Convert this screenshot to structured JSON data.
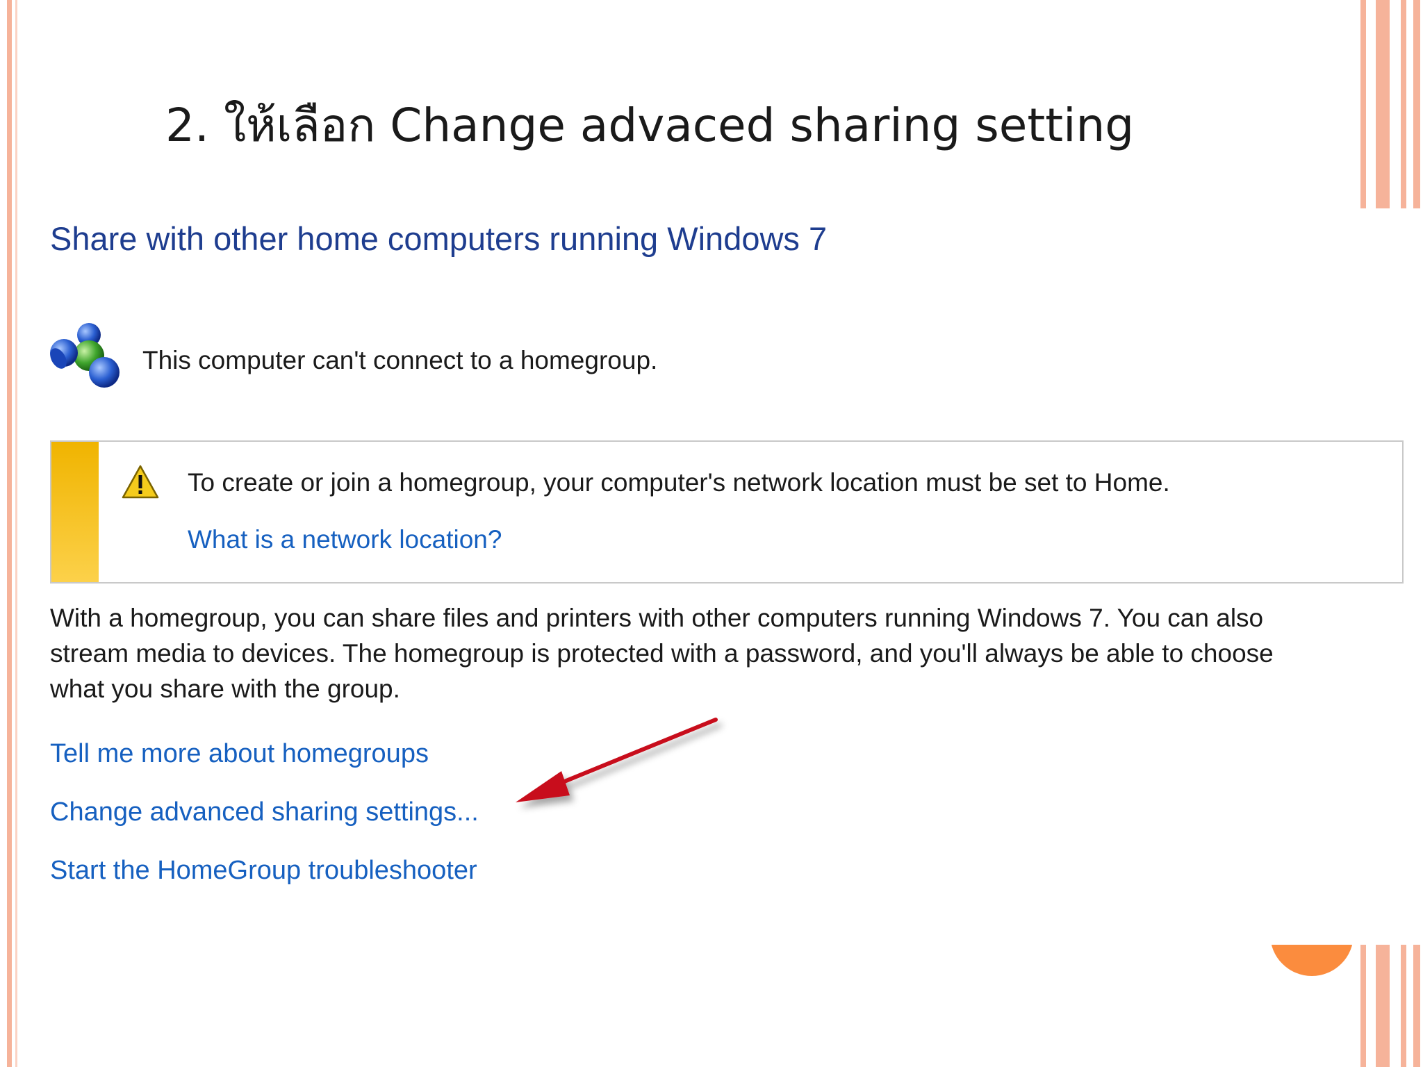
{
  "slide": {
    "title": "2. ให้เลือก Change advaced sharing setting"
  },
  "panel": {
    "heading": "Share with other home computers running Windows 7",
    "status_icon": "homegroup-icon",
    "status_text": "This computer can't connect to a homegroup.",
    "warning": {
      "icon": "warning-triangle-icon",
      "text": "To create or join a homegroup, your computer's network location must be set to Home.",
      "link": "What is a network location?"
    },
    "description_lines": [
      "With a homegroup, you can share files and printers with other computers running Windows 7. You can also",
      "stream media to devices. The homegroup is protected with a password, and you'll always be able to choose",
      "what you share with the group."
    ],
    "links": [
      "Tell me more about homegroups",
      "Change advanced sharing settings...",
      "Start the HomeGroup troubleshooter"
    ]
  },
  "colors": {
    "heading": "#1e3d8f",
    "link": "#1660c0",
    "warning_bar": "#f0b400",
    "accent_stripe": "#f6b39a",
    "accent_circle": "#fb8c3e",
    "arrow": "#c8101a"
  }
}
